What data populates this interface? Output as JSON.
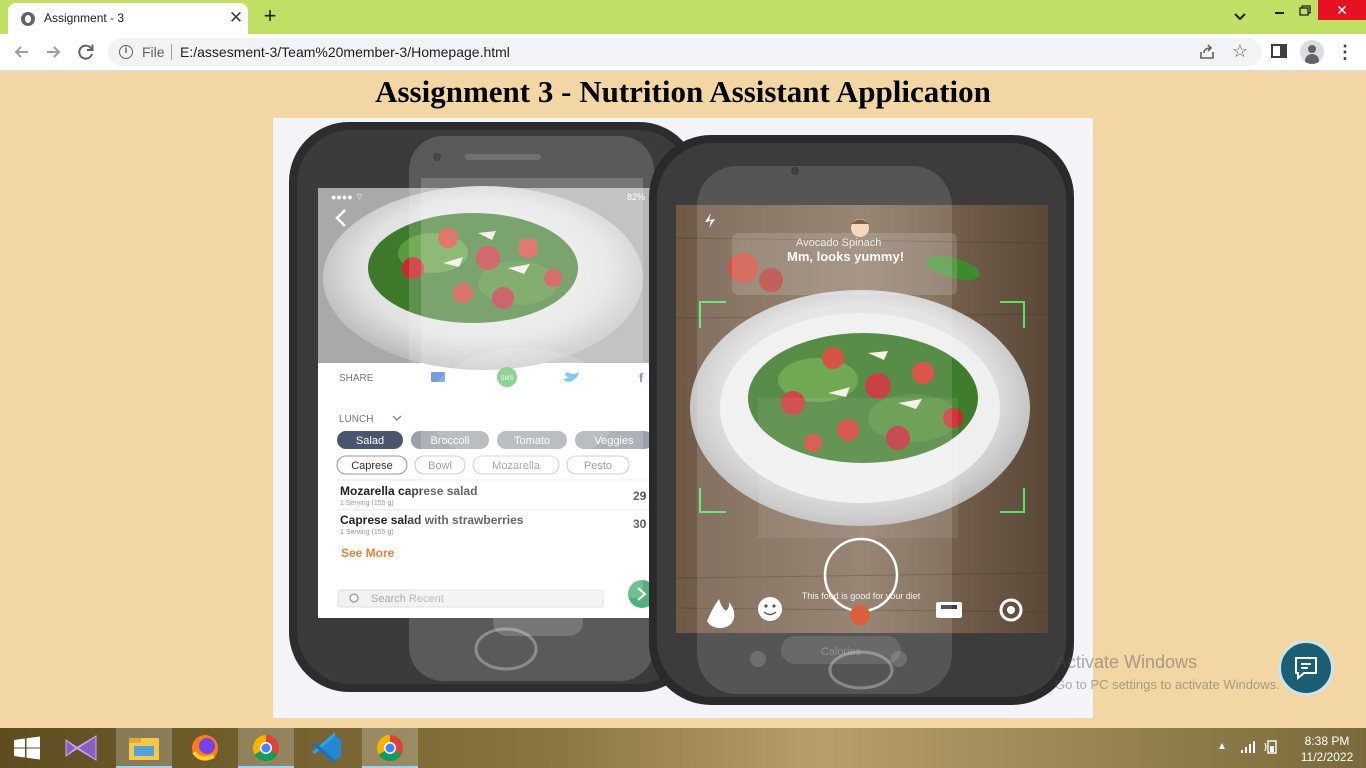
{
  "browser": {
    "tab_title": "Assignment - 3",
    "tab_close": "✕",
    "new_tab": "+",
    "file_label": "File",
    "url": "E:/assesment-3/Team%20member-3/Homepage.html"
  },
  "page": {
    "title": "Assignment 3 - Nutrition Assistant Application"
  },
  "phone_left": {
    "share_label": "SHARE",
    "sms_label": "SMS",
    "meal_label": "LUNCH",
    "category_chips": [
      "Salad",
      "Broccoli",
      "Tomato",
      "Veggies"
    ],
    "sub_chips": [
      "Caprese",
      "Bowl",
      "Mozarella",
      "Pesto"
    ],
    "results": [
      {
        "name": "Mozarella caprese salad",
        "serving": "1 Serving (155 g)",
        "value": "29"
      },
      {
        "name": "Caprese salad with strawberries",
        "serving": "1 Serving (155 g)",
        "value": "30"
      }
    ],
    "see_more": "See More",
    "search_placeholder": "Search Recent",
    "status_battery": "82%"
  },
  "phone_right": {
    "food_name": "Avocado Spinach",
    "reaction": "Mm, looks yummy!",
    "verdict": "This food is good for your diet",
    "faded_calories": "Calories"
  },
  "watermark": {
    "title": "Activate Windows",
    "subtitle": "Go to PC settings to activate Windows."
  },
  "taskbar": {
    "time": "8:38 PM",
    "date": "11/2/2022"
  },
  "colors": {
    "tabbar": "#bfe065",
    "page_background": "#f2d6a4",
    "chat_button": "#1b5f74",
    "scan_frame": "#5ee06a"
  }
}
